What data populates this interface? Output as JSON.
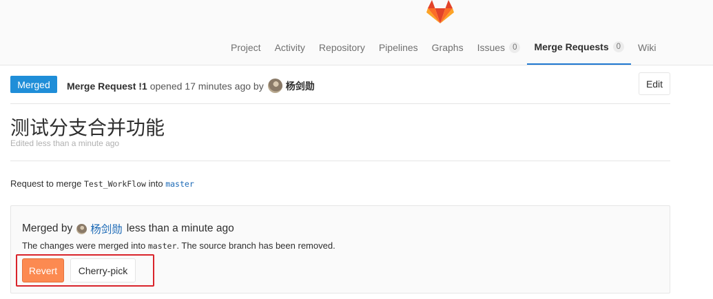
{
  "header": {
    "logo": "gitlab-fox-logo",
    "nav": [
      {
        "label": "Project"
      },
      {
        "label": "Activity"
      },
      {
        "label": "Repository"
      },
      {
        "label": "Pipelines"
      },
      {
        "label": "Graphs"
      },
      {
        "label": "Issues",
        "count": "0"
      },
      {
        "label": "Merge Requests",
        "count": "0",
        "active": true
      },
      {
        "label": "Wiki"
      }
    ]
  },
  "mr": {
    "status": "Merged",
    "reference": "Merge Request !1",
    "opened_text": "opened 17 minutes ago by",
    "author": "杨剑勋",
    "edit_label": "Edit",
    "title": "测试分支合并功能",
    "edited_text": "Edited less than a minute ago",
    "request_prefix": "Request to merge",
    "source_branch": "Test_WorkFlow",
    "into_text": "into",
    "target_branch": "master"
  },
  "merge_widget": {
    "merged_by_label": "Merged by",
    "merged_by": "杨剑勋",
    "merged_time": "less than a minute ago",
    "note_prefix": "The changes were merged into",
    "note_branch": "master",
    "note_suffix": ". The source branch has been removed.",
    "revert_label": "Revert",
    "cherry_pick_label": "Cherry-pick"
  },
  "colors": {
    "accent": "#1f78d1",
    "merged_badge": "#1f8ed8",
    "revert": "#fc8a51",
    "highlight_box": "#d9232a"
  }
}
